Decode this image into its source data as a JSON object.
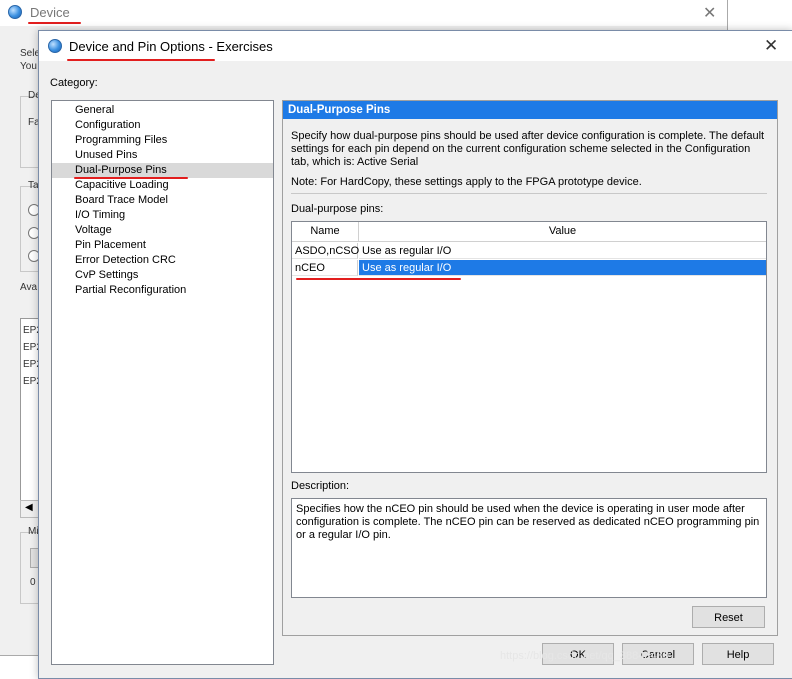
{
  "background_window": {
    "title": "Device",
    "close_glyph": "✕",
    "fragments": [
      "Sele",
      "You",
      "De",
      "Fa",
      "Ta",
      "Ava",
      "EP2",
      "EP2",
      "EP2",
      "EP2",
      "Mi",
      "0"
    ]
  },
  "dialog": {
    "title": "Device and Pin Options - Exercises",
    "close_glyph": "✕",
    "category_label": "Category:",
    "categories": [
      "General",
      "Configuration",
      "Programming Files",
      "Unused Pins",
      "Dual-Purpose Pins",
      "Capacitive Loading",
      "Board Trace Model",
      "I/O Timing",
      "Voltage",
      "Pin Placement",
      "Error Detection CRC",
      "CvP Settings",
      "Partial Reconfiguration"
    ],
    "selected_category": "Dual-Purpose Pins",
    "panel": {
      "header": "Dual-Purpose Pins",
      "description_top": "Specify how dual-purpose pins should be used after device configuration is complete. The default settings for each pin depend on the current configuration scheme selected in the Configuration tab, which is:  Active Serial",
      "note": "Note: For HardCopy, these settings apply to the FPGA prototype device.",
      "table_label": "Dual-purpose pins:",
      "columns": {
        "name": "Name",
        "value": "Value"
      },
      "rows": [
        {
          "name": "ASDO,nCSO",
          "value": "Use as regular I/O"
        },
        {
          "name": "nCEO",
          "value": "Use as regular I/O"
        }
      ],
      "selected_row": 1,
      "description_label": "Description:",
      "description_text": "Specifies how the nCEO pin should be used when the device is operating in user mode after configuration is complete. The nCEO pin can be reserved as dedicated nCEO programming pin or a regular I/O pin.",
      "reset_label": "Reset"
    },
    "buttons": {
      "ok": "OK",
      "cancel": "Cancel",
      "help": "Help"
    }
  },
  "watermark": "https://blog.csdn.net/qq_38843430",
  "colors": {
    "selection_blue": "#1e7ae6",
    "annotation_red": "#e21e1e",
    "category_selected": "#d9d9d9"
  },
  "icons": {
    "app_icon": "globe-app-icon",
    "close": "close-icon"
  }
}
